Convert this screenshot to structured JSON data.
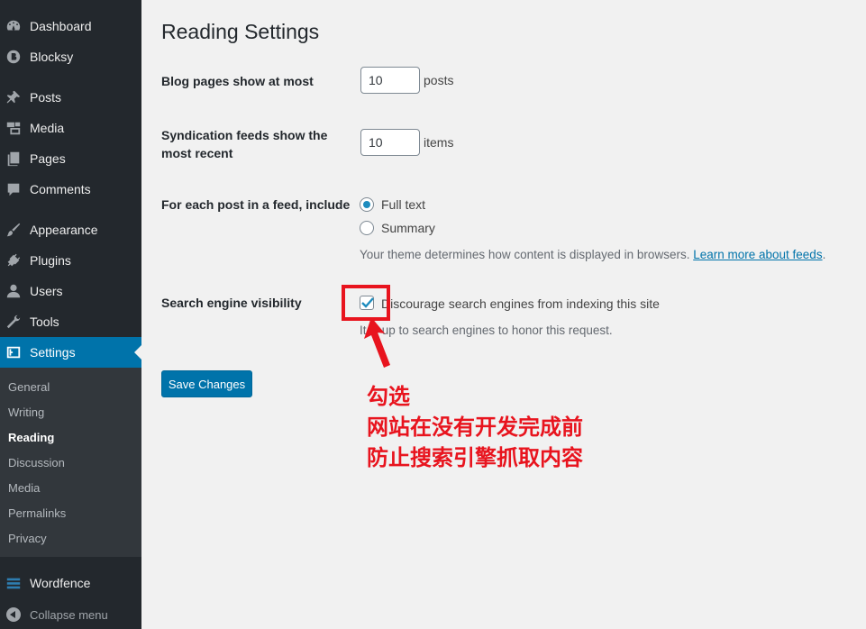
{
  "sidebar": {
    "items": [
      {
        "label": "Dashboard",
        "icon": "dashboard-icon"
      },
      {
        "label": "Blocksy",
        "icon": "blocksy-icon"
      },
      {
        "label": "Posts",
        "icon": "pin-icon"
      },
      {
        "label": "Media",
        "icon": "media-icon"
      },
      {
        "label": "Pages",
        "icon": "pages-icon"
      },
      {
        "label": "Comments",
        "icon": "comments-icon"
      },
      {
        "label": "Appearance",
        "icon": "brush-icon"
      },
      {
        "label": "Plugins",
        "icon": "plugin-icon"
      },
      {
        "label": "Users",
        "icon": "users-icon"
      },
      {
        "label": "Tools",
        "icon": "wrench-icon"
      },
      {
        "label": "Settings",
        "icon": "settings-icon"
      },
      {
        "label": "Wordfence",
        "icon": "wordfence-icon"
      }
    ],
    "submenu": [
      "General",
      "Writing",
      "Reading",
      "Discussion",
      "Media",
      "Permalinks",
      "Privacy"
    ],
    "collapse_label": "Collapse menu"
  },
  "page": {
    "title": "Reading Settings",
    "blog_pages": {
      "label": "Blog pages show at most",
      "value": "10",
      "unit": "posts"
    },
    "syndication": {
      "label_line1": "Syndication feeds show the",
      "label_line2": "most recent",
      "value": "10",
      "unit": "items"
    },
    "feed": {
      "label": "For each post in a feed, include",
      "options": [
        "Full text",
        "Summary"
      ],
      "selected": "Full text",
      "desc": "Your theme determines how content is displayed in browsers.",
      "link": "Learn more about feeds",
      "period": "."
    },
    "search": {
      "label": "Search engine visibility",
      "checkbox_label": "Discourage search engines from indexing this site",
      "checked": true,
      "desc": "It is up to search engines to honor this request."
    },
    "save_label": "Save Changes"
  },
  "annotation": {
    "lines": [
      "勾选",
      "网站在没有开发完成前",
      "防止搜索引擎抓取内容"
    ],
    "color": "#e8141e"
  },
  "colors": {
    "sidebar": "#23282d",
    "accent": "#0073aa",
    "background": "#f1f1f1"
  }
}
